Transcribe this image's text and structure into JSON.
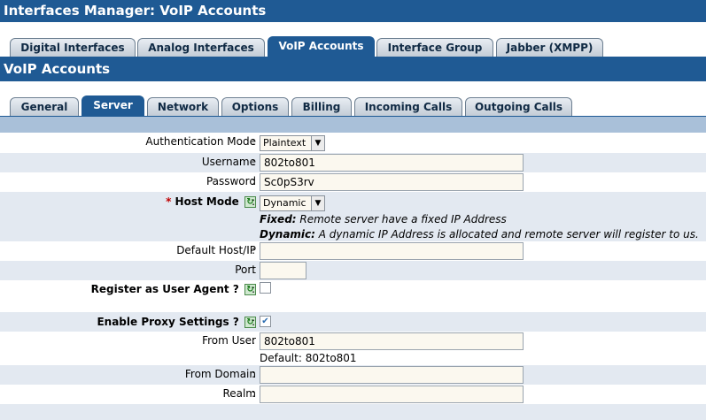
{
  "title": "Interfaces Manager:  VoIP Accounts",
  "top_tabs": [
    "Digital Interfaces",
    "Analog Interfaces",
    "VoIP Accounts",
    "Interface Group",
    "Jabber (XMPP)"
  ],
  "section_title": "VoIP Accounts",
  "sub_tabs": [
    "General",
    "Server",
    "Network",
    "Options",
    "Billing",
    "Incoming Calls",
    "Outgoing Calls"
  ],
  "form": {
    "auth_mode_label": "Authentication Mode",
    "auth_mode_value": "Plaintext",
    "username_label": "Username",
    "username_value": "802to801",
    "password_label": "Password",
    "password_value": "Sc0pS3rv",
    "host_mode_star": "*",
    "host_mode_label": "Host Mode",
    "host_mode_value": "Dynamic",
    "fixed_term": "Fixed:",
    "fixed_desc": " Remote server have a fixed IP Address",
    "dynamic_term": "Dynamic:",
    "dynamic_desc": " A dynamic IP Address is allocated and remote server will register to us.",
    "default_host_label": "Default Host/IP",
    "default_host_value": "",
    "port_label": "Port",
    "port_value": "",
    "register_ua_label": "Register as User Agent ?",
    "register_ua_checked": false,
    "proxy_label": "Enable Proxy Settings ?",
    "proxy_checked": true,
    "from_user_label": "From User",
    "from_user_value": "802to801",
    "from_user_default": "Default: 802to801",
    "from_domain_label": "From Domain",
    "from_domain_value": "",
    "realm_label": "Realm",
    "realm_value": "",
    "colon": ":",
    "help_icon_glyph": "↻",
    "check_glyph": "✔",
    "select_arrow_glyph": "▼"
  },
  "colors": {
    "header_blue": "#1f5a94",
    "band_blue": "#a9c0d9",
    "row_shade": "#e3e9f1",
    "input_bg": "#fbf8ef"
  }
}
